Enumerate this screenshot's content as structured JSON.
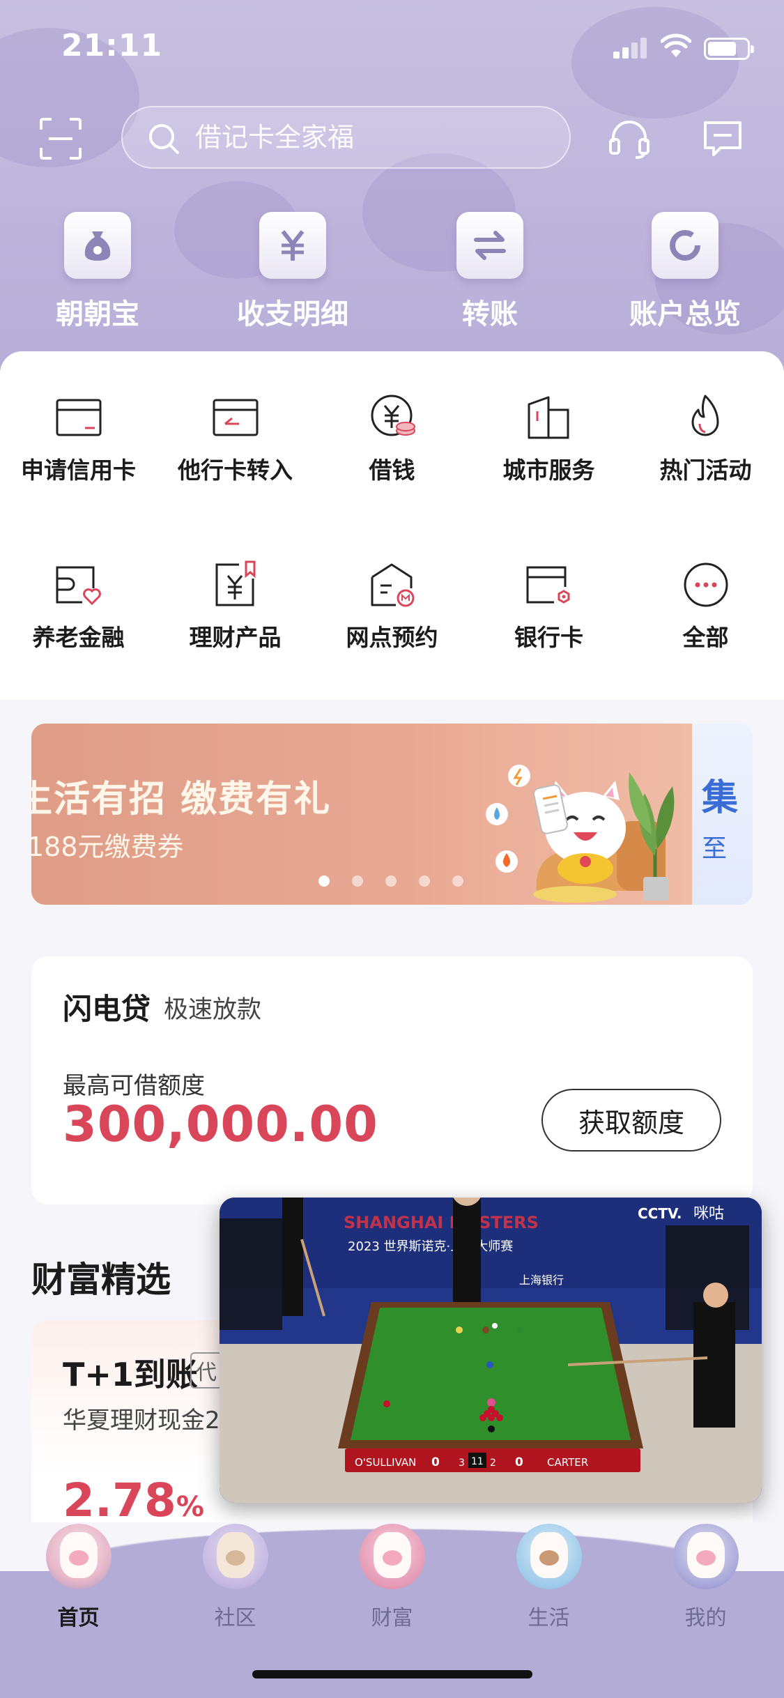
{
  "status_bar": {
    "time": "21:11"
  },
  "header": {
    "search": {
      "placeholder": "借记卡全家福"
    },
    "quick_actions": [
      {
        "label": "朝朝宝",
        "icon": "money-bag-icon"
      },
      {
        "label": "收支明细",
        "icon": "yuan-icon"
      },
      {
        "label": "转账",
        "icon": "transfer-icon"
      },
      {
        "label": "账户总览",
        "icon": "ring-chart-icon"
      }
    ]
  },
  "service_grid": [
    {
      "label": "申请信用卡",
      "icon": "credit-card-icon"
    },
    {
      "label": "他行卡转入",
      "icon": "card-transfer-in-icon"
    },
    {
      "label": "借钱",
      "icon": "yuan-coin-icon"
    },
    {
      "label": "城市服务",
      "icon": "city-building-icon"
    },
    {
      "label": "热门活动",
      "icon": "flame-icon"
    },
    {
      "label": "养老金融",
      "icon": "pension-card-icon"
    },
    {
      "label": "理财产品",
      "icon": "wealth-doc-icon"
    },
    {
      "label": "网点预约",
      "icon": "branch-appointment-icon"
    },
    {
      "label": "银行卡",
      "icon": "bank-card-icon"
    },
    {
      "label": "全部",
      "icon": "more-dots-icon"
    }
  ],
  "banner": {
    "title": "生活有招 缴费有礼",
    "subtitle": "188元缴费券",
    "next_title": "集",
    "next_subtitle": "至",
    "page_count": 5,
    "active_index": 0
  },
  "loan": {
    "title": "闪电贷",
    "subtitle": "极速放款",
    "limit_label": "最高可借额度",
    "amount": "300,000.00",
    "button": "获取额度"
  },
  "wealth": {
    "section_title": "财富精选",
    "product_title": "T+1到账",
    "product_tag": "代",
    "product_name": "华夏理财现金2",
    "rate_value": "2.78",
    "rate_unit": "%"
  },
  "video": {
    "event_title": "SHANGHAI MASTERS",
    "event_subtitle": "2023 世界斯诺克·上海大师赛",
    "broadcaster": "CCTV.",
    "partner": "咪咕",
    "bank_logo": "上海银行",
    "scoreboard": {
      "player1": "O'SULLIVAN",
      "score1": "0",
      "frames1": "3",
      "total": "11",
      "frames2": "2",
      "score2": "0",
      "player2": "CARTER"
    }
  },
  "tabs": [
    {
      "label": "首页",
      "active": true
    },
    {
      "label": "社区",
      "active": false
    },
    {
      "label": "财富",
      "active": false
    },
    {
      "label": "生活",
      "active": false
    },
    {
      "label": "我的",
      "active": false
    }
  ],
  "colors": {
    "header_purple": "#bdb4dc",
    "accent_red": "#d9465a",
    "banner_peach": "#e8a893",
    "tabbar_purple": "#b2acd6"
  }
}
